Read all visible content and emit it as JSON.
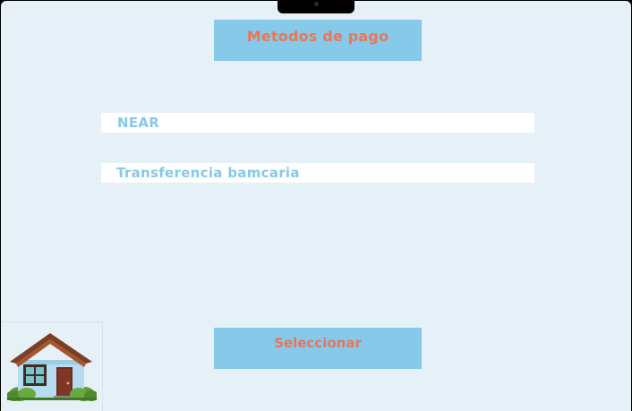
{
  "header": {
    "title": "Metodos de pago"
  },
  "payment_options": [
    {
      "label": "NEAR"
    },
    {
      "label": "Transferencia bamcaria"
    }
  ],
  "actions": {
    "select_label": "Seleccionar"
  },
  "icons": {
    "home": "house-icon"
  },
  "colors": {
    "background": "#e6f0f7",
    "accent_blue": "#86c9e8",
    "accent_orange": "#e8775a",
    "option_bg": "#ffffff"
  }
}
